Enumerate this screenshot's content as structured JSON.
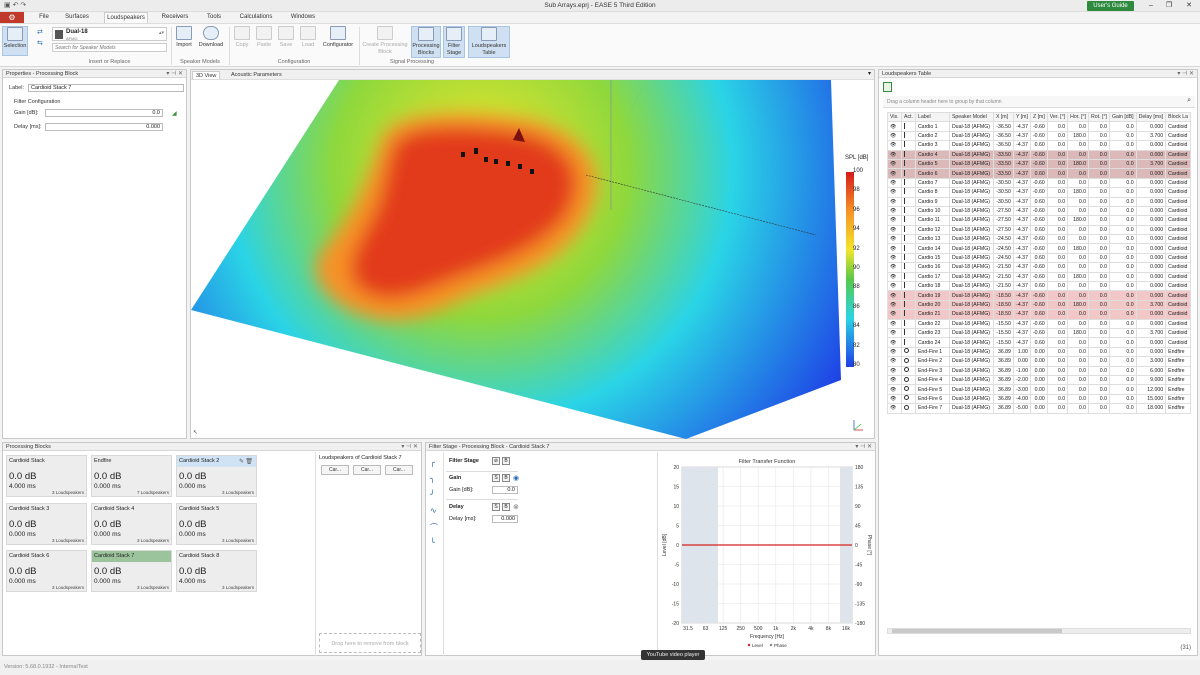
{
  "window": {
    "title": "Sub Arrays.eprj - EASE 5 Third Edition",
    "users_guide": "User's Guide"
  },
  "menu": {
    "file": "File",
    "surfaces": "Surfaces",
    "loudspeakers": "Loudspeakers",
    "receivers": "Receivers",
    "tools": "Tools",
    "calculations": "Calculations",
    "windows": "Windows"
  },
  "ribbon": {
    "selection": "Selection",
    "model_name": "Dual-18",
    "model_sub": "AFMG",
    "search_placeholder": "Search for Speaker Models",
    "group_insert": "Insert or Replace",
    "import": "Import",
    "download": "Download",
    "group_speaker_models": "Speaker Models",
    "copy": "Copy",
    "paste": "Paste",
    "save": "Save",
    "load": "Load",
    "configurator": "Configurator",
    "group_configuration": "Configuration",
    "create_pb": "Create Processing Block",
    "processing_blocks": "Processing Blocks",
    "filter_stage": "Filter Stage",
    "loudspeakers_table": "Loudspeakers Table",
    "group_signal": "Signal Processing"
  },
  "properties": {
    "header": "Properties - Processing Block",
    "label_caption": "Label:",
    "label_value": "Cardioid Stack 7",
    "filter_config": "Filter Configuration",
    "gain_label": "Gain [dB]:",
    "gain_value": "0.0",
    "delay_label": "Delay [ms]:",
    "delay_value": "0.000"
  },
  "view": {
    "tab_3d": "3D View",
    "tab_acoustic": "Acoustic Parameters",
    "legend_title": "SPL [dB]",
    "legend_ticks": [
      "100",
      "98",
      "96",
      "94",
      "92",
      "90",
      "88",
      "86",
      "84",
      "82",
      "80"
    ],
    "colors": {
      "red": "#e23a1e",
      "orange": "#f79226",
      "yellow": "#f2e62a",
      "green": "#58c84a",
      "cyan": "#2ad4e6",
      "blue": "#1e3ee6"
    }
  },
  "loudspeakers_table": {
    "header": "Loudspeakers Table",
    "group_hint": "Drag a column header here to group by that column",
    "columns": [
      "Vis.",
      "Act.",
      "Label",
      "Speaker Model",
      "X [m]",
      "Y [m]",
      "Z [m]",
      "Ver. [°]",
      "Hor. [°]",
      "Rot. [°]",
      "Gain [dB]",
      "Delay [ms]",
      "Block La"
    ],
    "rows": [
      [
        "Cardio 1",
        "Dual-18 (AFMG)",
        "-36.50",
        "-4.37",
        "-0.60",
        "0.0",
        "0.0",
        "0.0",
        "0.0",
        "0.000",
        "Cardioid"
      ],
      [
        "Cardio 2",
        "Dual-18 (AFMG)",
        "-36.50",
        "-4.37",
        "-0.60",
        "0.0",
        "180.0",
        "0.0",
        "0.0",
        "3.700",
        "Cardioid"
      ],
      [
        "Cardio 3",
        "Dual-18 (AFMG)",
        "-36.50",
        "-4.37",
        "0.60",
        "0.0",
        "0.0",
        "0.0",
        "0.0",
        "0.000",
        "Cardioid"
      ],
      [
        "Cardio 4",
        "Dual-18 (AFMG)",
        "-33.50",
        "-4.37",
        "-0.60",
        "0.0",
        "0.0",
        "0.0",
        "0.0",
        "0.000",
        "Cardioid"
      ],
      [
        "Cardio 5",
        "Dual-18 (AFMG)",
        "-33.50",
        "-4.37",
        "-0.60",
        "0.0",
        "180.0",
        "0.0",
        "0.0",
        "3.700",
        "Cardioid"
      ],
      [
        "Cardio 6",
        "Dual-18 (AFMG)",
        "-33.50",
        "-4.37",
        "0.60",
        "0.0",
        "0.0",
        "0.0",
        "0.0",
        "0.000",
        "Cardioid"
      ],
      [
        "Cardio 7",
        "Dual-18 (AFMG)",
        "-30.50",
        "-4.37",
        "-0.60",
        "0.0",
        "0.0",
        "0.0",
        "0.0",
        "0.000",
        "Cardioid"
      ],
      [
        "Cardio 8",
        "Dual-18 (AFMG)",
        "-30.50",
        "-4.37",
        "-0.60",
        "0.0",
        "180.0",
        "0.0",
        "0.0",
        "0.000",
        "Cardioid"
      ],
      [
        "Cardio 9",
        "Dual-18 (AFMG)",
        "-30.50",
        "-4.37",
        "0.60",
        "0.0",
        "0.0",
        "0.0",
        "0.0",
        "0.000",
        "Cardioid"
      ],
      [
        "Cardio 10",
        "Dual-18 (AFMG)",
        "-27.50",
        "-4.37",
        "-0.60",
        "0.0",
        "0.0",
        "0.0",
        "0.0",
        "0.000",
        "Cardioid"
      ],
      [
        "Cardio 11",
        "Dual-18 (AFMG)",
        "-27.50",
        "-4.37",
        "-0.60",
        "0.0",
        "180.0",
        "0.0",
        "0.0",
        "0.000",
        "Cardioid"
      ],
      [
        "Cardio 12",
        "Dual-18 (AFMG)",
        "-27.50",
        "-4.37",
        "0.60",
        "0.0",
        "0.0",
        "0.0",
        "0.0",
        "0.000",
        "Cardioid"
      ],
      [
        "Cardio 13",
        "Dual-18 (AFMG)",
        "-24.50",
        "-4.37",
        "-0.60",
        "0.0",
        "0.0",
        "0.0",
        "0.0",
        "0.000",
        "Cardioid"
      ],
      [
        "Cardio 14",
        "Dual-18 (AFMG)",
        "-24.50",
        "-4.37",
        "-0.60",
        "0.0",
        "180.0",
        "0.0",
        "0.0",
        "0.000",
        "Cardioid"
      ],
      [
        "Cardio 15",
        "Dual-18 (AFMG)",
        "-24.50",
        "-4.37",
        "0.60",
        "0.0",
        "0.0",
        "0.0",
        "0.0",
        "0.000",
        "Cardioid"
      ],
      [
        "Cardio 16",
        "Dual-18 (AFMG)",
        "-21.50",
        "-4.37",
        "-0.60",
        "0.0",
        "0.0",
        "0.0",
        "0.0",
        "0.000",
        "Cardioid"
      ],
      [
        "Cardio 17",
        "Dual-18 (AFMG)",
        "-21.50",
        "-4.37",
        "-0.60",
        "0.0",
        "180.0",
        "0.0",
        "0.0",
        "0.000",
        "Cardioid"
      ],
      [
        "Cardio 18",
        "Dual-18 (AFMG)",
        "-21.50",
        "-4.37",
        "0.60",
        "0.0",
        "0.0",
        "0.0",
        "0.0",
        "0.000",
        "Cardioid"
      ],
      [
        "Cardio 19",
        "Dual-18 (AFMG)",
        "-18.50",
        "-4.37",
        "-0.60",
        "0.0",
        "0.0",
        "0.0",
        "0.0",
        "0.000",
        "Cardioid"
      ],
      [
        "Cardio 20",
        "Dual-18 (AFMG)",
        "-18.50",
        "-4.37",
        "-0.60",
        "0.0",
        "180.0",
        "0.0",
        "0.0",
        "3.700",
        "Cardioid"
      ],
      [
        "Cardio 21",
        "Dual-18 (AFMG)",
        "-18.50",
        "-4.37",
        "0.60",
        "0.0",
        "0.0",
        "0.0",
        "0.0",
        "0.000",
        "Cardioid"
      ],
      [
        "Cardio 22",
        "Dual-18 (AFMG)",
        "-15.50",
        "-4.37",
        "-0.60",
        "0.0",
        "0.0",
        "0.0",
        "0.0",
        "0.000",
        "Cardioid"
      ],
      [
        "Cardio 23",
        "Dual-18 (AFMG)",
        "-15.50",
        "-4.37",
        "-0.60",
        "0.0",
        "180.0",
        "0.0",
        "0.0",
        "3.700",
        "Cardioid"
      ],
      [
        "Cardio 24",
        "Dual-18 (AFMG)",
        "-15.50",
        "-4.37",
        "0.60",
        "0.0",
        "0.0",
        "0.0",
        "0.0",
        "0.000",
        "Cardioid"
      ],
      [
        "End-Fire 1",
        "Dual-18 (AFMG)",
        "36.89",
        "1.00",
        "0.00",
        "0.0",
        "0.0",
        "0.0",
        "0.0",
        "0.000",
        "Endfire"
      ],
      [
        "End-Fire 2",
        "Dual-18 (AFMG)",
        "36.89",
        "0.00",
        "0.00",
        "0.0",
        "0.0",
        "0.0",
        "0.0",
        "3.000",
        "Endfire"
      ],
      [
        "End-Fire 3",
        "Dual-18 (AFMG)",
        "36.89",
        "-1.00",
        "0.00",
        "0.0",
        "0.0",
        "0.0",
        "0.0",
        "6.000",
        "Endfire"
      ],
      [
        "End-Fire 4",
        "Dual-18 (AFMG)",
        "36.89",
        "-2.00",
        "0.00",
        "0.0",
        "0.0",
        "0.0",
        "0.0",
        "9.000",
        "Endfire"
      ],
      [
        "End-Fire 5",
        "Dual-18 (AFMG)",
        "36.89",
        "-3.00",
        "0.00",
        "0.0",
        "0.0",
        "0.0",
        "0.0",
        "12.000",
        "Endfire"
      ],
      [
        "End-Fire 6",
        "Dual-18 (AFMG)",
        "36.89",
        "-4.00",
        "0.00",
        "0.0",
        "0.0",
        "0.0",
        "0.0",
        "15.000",
        "Endfire"
      ],
      [
        "End-Fire 7",
        "Dual-18 (AFMG)",
        "36.89",
        "-5.00",
        "0.00",
        "0.0",
        "0.0",
        "0.0",
        "0.0",
        "18.000",
        "Endfire"
      ]
    ],
    "count": "(31)"
  },
  "processing_blocks": {
    "header": "Processing Blocks",
    "cards": [
      {
        "name": "Cardioid Stack",
        "gain": "0.0 dB",
        "delay": "4.000 ms",
        "count": "3 Loudspeakers"
      },
      {
        "name": "Endfire",
        "gain": "0.0 dB",
        "delay": "0.000 ms",
        "count": "7 Loudspeakers"
      },
      {
        "name": "Cardioid Stack 2",
        "gain": "0.0 dB",
        "delay": "0.000 ms",
        "count": "3 Loudspeakers"
      },
      {
        "name": "Cardioid Stack 3",
        "gain": "0.0 dB",
        "delay": "0.000 ms",
        "count": "3 Loudspeakers"
      },
      {
        "name": "Cardioid Stack 4",
        "gain": "0.0 dB",
        "delay": "0.000 ms",
        "count": "3 Loudspeakers"
      },
      {
        "name": "Cardioid Stack 5",
        "gain": "0.0 dB",
        "delay": "0.000 ms",
        "count": "3 Loudspeakers"
      },
      {
        "name": "Cardioid Stack 6",
        "gain": "0.0 dB",
        "delay": "0.000 ms",
        "count": "3 Loudspeakers"
      },
      {
        "name": "Cardioid Stack 7",
        "gain": "0.0 dB",
        "delay": "0.000 ms",
        "count": "3 Loudspeakers"
      },
      {
        "name": "Cardioid Stack 8",
        "gain": "0.0 dB",
        "delay": "4.000 ms",
        "count": "3 Loudspeakers"
      }
    ],
    "members_title": "Loudspeakers of Cardioid Stack 7",
    "members": [
      "Car...",
      "Car...",
      "Car..."
    ],
    "drop_hint": "Drop here to remove from block"
  },
  "filter_stage": {
    "header": "Filter Stage - Processing Block - Cardioid Stack 7",
    "filter_stage_label": "Filter Stage",
    "gain_section": "Gain",
    "gain_label": "Gain [dB]:",
    "gain_value": "0.0",
    "delay_section": "Delay",
    "delay_label": "Delay [ms]:",
    "delay_value": "0.000",
    "s": "S",
    "b": "B"
  },
  "chart_data": {
    "type": "line",
    "title": "Filter Transfer Function",
    "xlabel": "Frequency [Hz]",
    "ylabel": "Level [dB]",
    "y2label": "Phase [°]",
    "x_ticks": [
      "31.5",
      "63",
      "125",
      "250",
      "500",
      "1k",
      "2k",
      "4k",
      "8k",
      "16k"
    ],
    "y_ticks": [
      "20",
      "15",
      "10",
      "5",
      "0",
      "-5",
      "-10",
      "-15",
      "-20"
    ],
    "y2_ticks": [
      "180",
      "135",
      "90",
      "45",
      "0",
      "-45",
      "-90",
      "-135",
      "-180"
    ],
    "ylim": [
      -20,
      20
    ],
    "y2lim": [
      -180,
      180
    ],
    "series": [
      {
        "name": "Level",
        "x": [
          "31.5",
          "63",
          "125",
          "250",
          "500",
          "1k",
          "2k",
          "4k",
          "8k",
          "16k"
        ],
        "values": [
          0,
          0,
          0,
          0,
          0,
          0,
          0,
          0,
          0,
          0
        ],
        "color": "#d62020"
      },
      {
        "name": "Phase",
        "x": [
          "31.5",
          "63",
          "125",
          "250",
          "500",
          "1k",
          "2k",
          "4k",
          "8k",
          "16k"
        ],
        "values": [
          0,
          0,
          0,
          0,
          0,
          0,
          0,
          0,
          0,
          0
        ],
        "color": "#888888"
      }
    ],
    "legend": "bottom"
  },
  "status": {
    "version": "Version: 5.68.0.1932 - InternalTest"
  },
  "overlay": {
    "youtube": "YouTube video player"
  }
}
